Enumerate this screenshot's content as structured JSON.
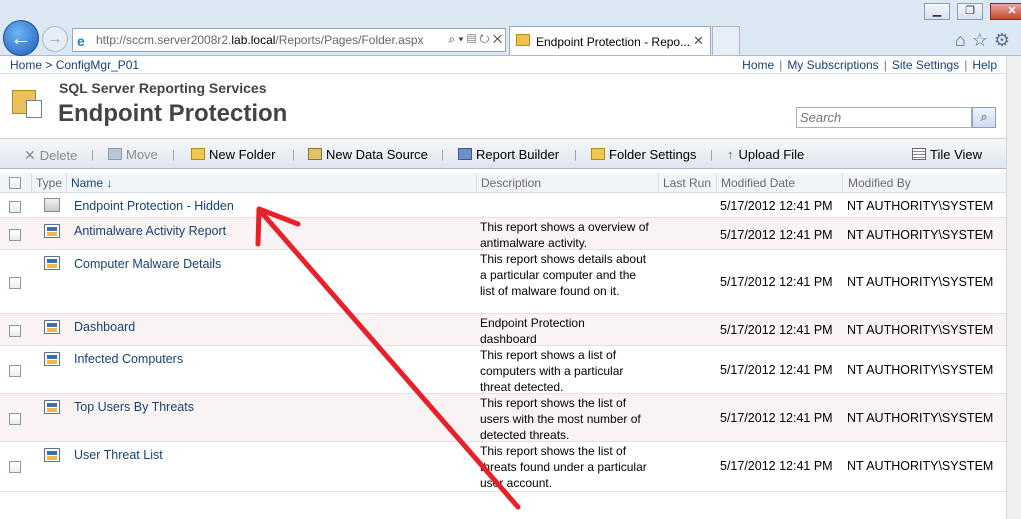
{
  "browser": {
    "url_prefix": "http://sccm.server2008r2.",
    "url_domain": "lab.local",
    "url_suffix": "/Reports/Pages/Folder.aspx",
    "tab_title": "Endpoint Protection - Repo..."
  },
  "nav": {
    "crumb_home": "Home",
    "crumb_sep": ">",
    "crumb_site": "ConfigMgr_P01",
    "links": [
      "Home",
      "My Subscriptions",
      "Site Settings",
      "Help"
    ]
  },
  "header": {
    "product": "SQL Server Reporting Services",
    "title": "Endpoint Protection",
    "search_placeholder": "Search"
  },
  "toolbar": {
    "delete": "Delete",
    "move": "Move",
    "new_folder": "New Folder",
    "new_data_source": "New Data Source",
    "report_builder": "Report Builder",
    "folder_settings": "Folder Settings",
    "upload_file": "Upload File",
    "tile_view": "Tile View"
  },
  "columns": {
    "type": "Type",
    "name": "Name",
    "sort_indicator": "↓",
    "description": "Description",
    "last_run": "Last Run",
    "modified_date": "Modified Date",
    "modified_by": "Modified By"
  },
  "items": [
    {
      "name": "Endpoint Protection - Hidden",
      "type": "folder",
      "description": "",
      "modified_date": "5/17/2012 12:41 PM",
      "modified_by": "NT AUTHORITY\\SYSTEM"
    },
    {
      "name": "Antimalware Activity Report",
      "type": "report",
      "description": "This report shows a overview of antimalware activity.",
      "modified_date": "5/17/2012 12:41 PM",
      "modified_by": "NT AUTHORITY\\SYSTEM"
    },
    {
      "name": "Computer Malware Details",
      "type": "report",
      "description": "This report shows details about a particular computer and the list of malware found on it.",
      "modified_date": "5/17/2012 12:41 PM",
      "modified_by": "NT AUTHORITY\\SYSTEM"
    },
    {
      "name": "Dashboard",
      "type": "report",
      "description": "Endpoint Protection dashboard",
      "modified_date": "5/17/2012 12:41 PM",
      "modified_by": "NT AUTHORITY\\SYSTEM"
    },
    {
      "name": "Infected Computers",
      "type": "report",
      "description": "This report shows a list of computers with a particular threat detected.",
      "modified_date": "5/17/2012 12:41 PM",
      "modified_by": "NT AUTHORITY\\SYSTEM"
    },
    {
      "name": "Top Users By Threats",
      "type": "report",
      "description": "This report shows the list of users with the most number of detected threats.",
      "modified_date": "5/17/2012 12:41 PM",
      "modified_by": "NT AUTHORITY\\SYSTEM"
    },
    {
      "name": "User Threat List",
      "type": "report",
      "description": "This report shows the list of threats found under a particular user account.",
      "modified_date": "5/17/2012 12:41 PM",
      "modified_by": "NT AUTHORITY\\SYSTEM"
    }
  ],
  "annotation": {
    "arrow_color": "#e8202a"
  }
}
